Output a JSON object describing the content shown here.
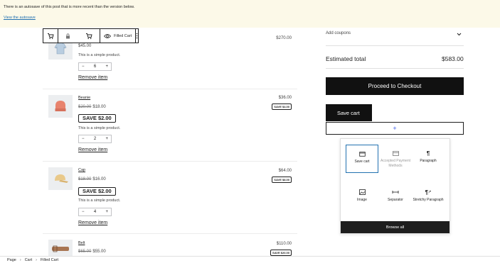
{
  "notice": {
    "message": "There is an autosave of this post that is more recent than the version below.",
    "link": "View the autosave"
  },
  "toolbar": {
    "label": "Filled Cart",
    "icons": [
      "cart-icon",
      "lock-icon",
      "cart-icon",
      "eye-icon",
      "more-vertical-icon"
    ]
  },
  "cart_items": [
    {
      "price": "$45.00",
      "description": "This is a simple product.",
      "quantity": "6",
      "remove_label": "Remove item",
      "line_total": "$270.00"
    },
    {
      "name": "Beanie",
      "old_price": "$20.00",
      "price": "$18.00",
      "save_badge": "SAVE $2.00",
      "description": "This is a simple product.",
      "quantity": "2",
      "remove_label": "Remove item",
      "line_total": "$36.00",
      "line_save": "SAVE $4.00"
    },
    {
      "name": "Cap",
      "old_price": "$18.00",
      "price": "$16.00",
      "save_badge": "SAVE $2.00",
      "description": "This is a simple product.",
      "quantity": "4",
      "remove_label": "Remove item",
      "line_total": "$64.00",
      "line_save": "SAVE $8.00"
    },
    {
      "name": "Belt",
      "old_price": "$65.00",
      "price": "$55.00",
      "line_total": "$110.00",
      "line_save": "SAVE $20.00"
    }
  ],
  "qty_controls": {
    "minus": "−",
    "plus": "+"
  },
  "sidebar": {
    "coupons_label": "Add coupons",
    "estimated_total_label": "Estimated total",
    "estimated_total_value": "$583.00",
    "checkout_label": "Proceed to Checkout",
    "save_cart_label": "Save cart",
    "appender_label": "+"
  },
  "inserter": {
    "items": [
      {
        "label": "Save cart",
        "icon": "save-cart-icon"
      },
      {
        "label": "Accepted Payment Methods",
        "icon": "payment-card-icon"
      },
      {
        "label": "Paragraph",
        "icon": "paragraph-icon"
      },
      {
        "label": "Image",
        "icon": "image-icon"
      },
      {
        "label": "Separator",
        "icon": "separator-icon"
      },
      {
        "label": "Stretchy Paragraph",
        "icon": "stretchy-paragraph-icon"
      }
    ],
    "browse_all": "Browse all"
  },
  "breadcrumb": [
    "Page",
    "Cart",
    "Filled Cart"
  ],
  "colors": {
    "accent": "#3858e9",
    "link": "#2271b1",
    "notice_bg": "#fcf9e8",
    "dark": "#111111"
  }
}
